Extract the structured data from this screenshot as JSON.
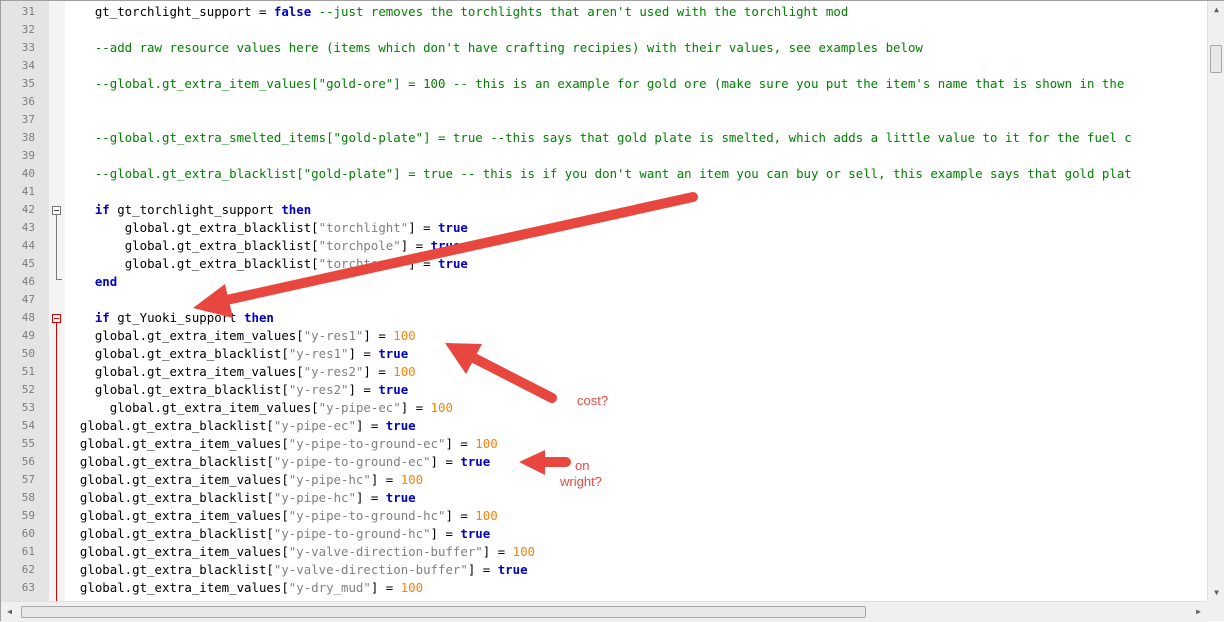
{
  "editor": {
    "lines": [
      {
        "n": "31",
        "indent": "    ",
        "tokens": [
          {
            "t": "gt_torchlight_support = "
          },
          {
            "t": "false",
            "c": "kw"
          },
          {
            "t": " --just removes the torchlights that aren't used with the torchlight mod",
            "c": "cm"
          }
        ]
      },
      {
        "n": "32",
        "indent": "",
        "tokens": []
      },
      {
        "n": "33",
        "indent": "    ",
        "tokens": [
          {
            "t": "--add raw resource values here (items which don't have crafting recipies) with their values, see examples below",
            "c": "cm"
          }
        ]
      },
      {
        "n": "34",
        "indent": "",
        "tokens": []
      },
      {
        "n": "35",
        "indent": "    ",
        "tokens": [
          {
            "t": "--global.gt_extra_item_values[\"gold-ore\"] = 100 -- this is an example for gold ore (make sure you put the item's name that is shown in the",
            "c": "cm"
          }
        ]
      },
      {
        "n": "36",
        "indent": "",
        "tokens": []
      },
      {
        "n": "37",
        "indent": "",
        "tokens": []
      },
      {
        "n": "38",
        "indent": "    ",
        "tokens": [
          {
            "t": "--global.gt_extra_smelted_items[\"gold-plate\"] = true --this says that gold plate is smelted, which adds a little value to it for the fuel c",
            "c": "cm"
          }
        ]
      },
      {
        "n": "39",
        "indent": "",
        "tokens": []
      },
      {
        "n": "40",
        "indent": "    ",
        "tokens": [
          {
            "t": "--global.gt_extra_blacklist[\"gold-plate\"] = true -- this is if you don't want an item you can buy or sell, this example says that gold plat",
            "c": "cm"
          }
        ]
      },
      {
        "n": "41",
        "indent": "",
        "tokens": []
      },
      {
        "n": "42",
        "indent": "    ",
        "tokens": [
          {
            "t": "if",
            "c": "kw"
          },
          {
            "t": " gt_torchlight_support "
          },
          {
            "t": "then",
            "c": "kw"
          }
        ]
      },
      {
        "n": "43",
        "indent": "        ",
        "tokens": [
          {
            "t": "global.gt_extra_blacklist["
          },
          {
            "t": "\"torchlight\"",
            "c": "str"
          },
          {
            "t": "] = "
          },
          {
            "t": "true",
            "c": "kw"
          }
        ]
      },
      {
        "n": "44",
        "indent": "        ",
        "tokens": [
          {
            "t": "global.gt_extra_blacklist["
          },
          {
            "t": "\"torchpole\"",
            "c": "str"
          },
          {
            "t": "] = "
          },
          {
            "t": "true",
            "c": "kw"
          }
        ]
      },
      {
        "n": "45",
        "indent": "        ",
        "tokens": [
          {
            "t": "global.gt_extra_blacklist["
          },
          {
            "t": "\"torchtower\"",
            "c": "str"
          },
          {
            "t": "] = "
          },
          {
            "t": "true",
            "c": "kw"
          }
        ]
      },
      {
        "n": "46",
        "indent": "    ",
        "tokens": [
          {
            "t": "end",
            "c": "kw"
          }
        ]
      },
      {
        "n": "47",
        "indent": "",
        "tokens": []
      },
      {
        "n": "48",
        "indent": "    ",
        "tokens": [
          {
            "t": "if",
            "c": "kw"
          },
          {
            "t": " gt_Yuoki_support "
          },
          {
            "t": "then",
            "c": "kw"
          }
        ]
      },
      {
        "n": "49",
        "indent": "    ",
        "tokens": [
          {
            "t": "global.gt_extra_item_values["
          },
          {
            "t": "\"y-res1\"",
            "c": "str"
          },
          {
            "t": "] = "
          },
          {
            "t": "100",
            "c": "num"
          }
        ]
      },
      {
        "n": "50",
        "indent": "    ",
        "tokens": [
          {
            "t": "global.gt_extra_blacklist["
          },
          {
            "t": "\"y-res1\"",
            "c": "str"
          },
          {
            "t": "] = "
          },
          {
            "t": "true",
            "c": "kw"
          }
        ]
      },
      {
        "n": "51",
        "indent": "    ",
        "tokens": [
          {
            "t": "global.gt_extra_item_values["
          },
          {
            "t": "\"y-res2\"",
            "c": "str"
          },
          {
            "t": "] = "
          },
          {
            "t": "100",
            "c": "num"
          }
        ]
      },
      {
        "n": "52",
        "indent": "    ",
        "tokens": [
          {
            "t": "global.gt_extra_blacklist["
          },
          {
            "t": "\"y-res2\"",
            "c": "str"
          },
          {
            "t": "] = "
          },
          {
            "t": "true",
            "c": "kw"
          }
        ]
      },
      {
        "n": "53",
        "indent": "      ",
        "tokens": [
          {
            "t": "global.gt_extra_item_values["
          },
          {
            "t": "\"y-pipe-ec\"",
            "c": "str"
          },
          {
            "t": "] = "
          },
          {
            "t": "100",
            "c": "num"
          }
        ]
      },
      {
        "n": "54",
        "indent": "  ",
        "tokens": [
          {
            "t": "global.gt_extra_blacklist["
          },
          {
            "t": "\"y-pipe-ec\"",
            "c": "str"
          },
          {
            "t": "] = "
          },
          {
            "t": "true",
            "c": "kw"
          }
        ]
      },
      {
        "n": "55",
        "indent": "  ",
        "tokens": [
          {
            "t": "global.gt_extra_item_values["
          },
          {
            "t": "\"y-pipe-to-ground-ec\"",
            "c": "str"
          },
          {
            "t": "] = "
          },
          {
            "t": "100",
            "c": "num"
          }
        ]
      },
      {
        "n": "56",
        "indent": "  ",
        "tokens": [
          {
            "t": "global.gt_extra_blacklist["
          },
          {
            "t": "\"y-pipe-to-ground-ec\"",
            "c": "str"
          },
          {
            "t": "] = "
          },
          {
            "t": "true",
            "c": "kw"
          }
        ]
      },
      {
        "n": "57",
        "indent": "  ",
        "tokens": [
          {
            "t": "global.gt_extra_item_values["
          },
          {
            "t": "\"y-pipe-hc\"",
            "c": "str"
          },
          {
            "t": "] = "
          },
          {
            "t": "100",
            "c": "num"
          }
        ]
      },
      {
        "n": "58",
        "indent": "  ",
        "tokens": [
          {
            "t": "global.gt_extra_blacklist["
          },
          {
            "t": "\"y-pipe-hc\"",
            "c": "str"
          },
          {
            "t": "] = "
          },
          {
            "t": "true",
            "c": "kw"
          }
        ]
      },
      {
        "n": "59",
        "indent": "  ",
        "tokens": [
          {
            "t": "global.gt_extra_item_values["
          },
          {
            "t": "\"y-pipe-to-ground-hc\"",
            "c": "str"
          },
          {
            "t": "] = "
          },
          {
            "t": "100",
            "c": "num"
          }
        ]
      },
      {
        "n": "60",
        "indent": "  ",
        "tokens": [
          {
            "t": "global.gt_extra_blacklist["
          },
          {
            "t": "\"y-pipe-to-ground-hc\"",
            "c": "str"
          },
          {
            "t": "] = "
          },
          {
            "t": "true",
            "c": "kw"
          }
        ]
      },
      {
        "n": "61",
        "indent": "  ",
        "tokens": [
          {
            "t": "global.gt_extra_item_values["
          },
          {
            "t": "\"y-valve-direction-buffer\"",
            "c": "str"
          },
          {
            "t": "] = "
          },
          {
            "t": "100",
            "c": "num"
          }
        ]
      },
      {
        "n": "62",
        "indent": "  ",
        "tokens": [
          {
            "t": "global.gt_extra_blacklist["
          },
          {
            "t": "\"y-valve-direction-buffer\"",
            "c": "str"
          },
          {
            "t": "] = "
          },
          {
            "t": "true",
            "c": "kw"
          }
        ]
      },
      {
        "n": "63",
        "indent": "  ",
        "tokens": [
          {
            "t": "global.gt_extra_item_values["
          },
          {
            "t": "\"y-dry_mud\"",
            "c": "str"
          },
          {
            "t": "] = "
          },
          {
            "t": "100",
            "c": "num"
          }
        ]
      }
    ]
  },
  "annotations": {
    "cost_note": "cost?",
    "wright_note_1": "on",
    "wright_note_2": "wright?",
    "arrow_color": "#e8473f"
  },
  "colors": {
    "keyword": "#0000c8",
    "string": "#808080",
    "number": "#ff8000",
    "comment": "#008000"
  }
}
